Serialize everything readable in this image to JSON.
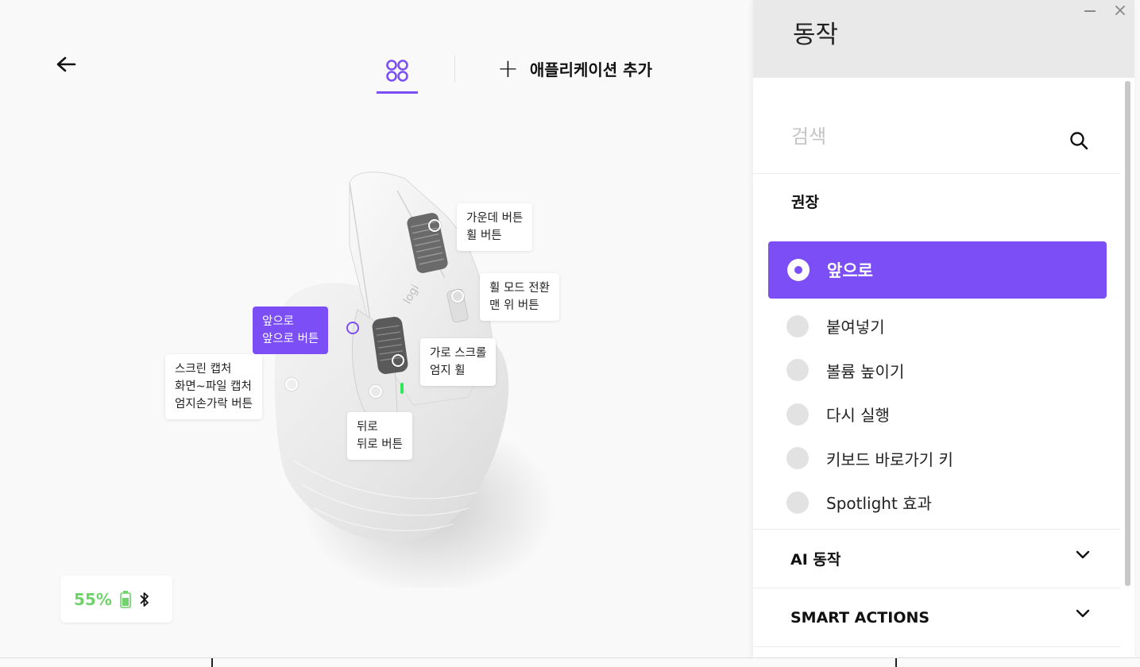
{
  "nav": {
    "add_app_label": "애플리케이션 추가"
  },
  "mouse": {
    "callouts": {
      "middle": {
        "line1": "가운데 버튼",
        "line2": "휠 버튼"
      },
      "wheel_mode": {
        "line1": "휠 모드 전환",
        "line2": "맨 위 버튼"
      },
      "forward": {
        "line1": "앞으로",
        "line2": "앞으로 버튼"
      },
      "horizontal": {
        "line1": "가로 스크롤",
        "line2": "엄지 휠"
      },
      "gesture": {
        "line1": "스크린 캡처",
        "line2": "화면~파일 캡처",
        "line3": "엄지손가락 버튼"
      },
      "back": {
        "line1": "뒤로",
        "line2": "뒤로 버튼"
      }
    },
    "logo_text": "logi"
  },
  "battery": {
    "percent": "55%",
    "color": "#6fd26a"
  },
  "panel": {
    "title": "동작",
    "search_placeholder": "검색",
    "recommended_label": "권장",
    "selected_action": "앞으로",
    "actions": [
      "붙여넣기",
      "볼륨 높이기",
      "다시 실행",
      "키보드 바로가기 키",
      "Spotlight 효과"
    ],
    "sections": [
      "AI 동작",
      "SMART ACTIONS"
    ]
  },
  "colors": {
    "accent": "#7b4ff5",
    "panel_header_bg": "#e9e9e9"
  }
}
